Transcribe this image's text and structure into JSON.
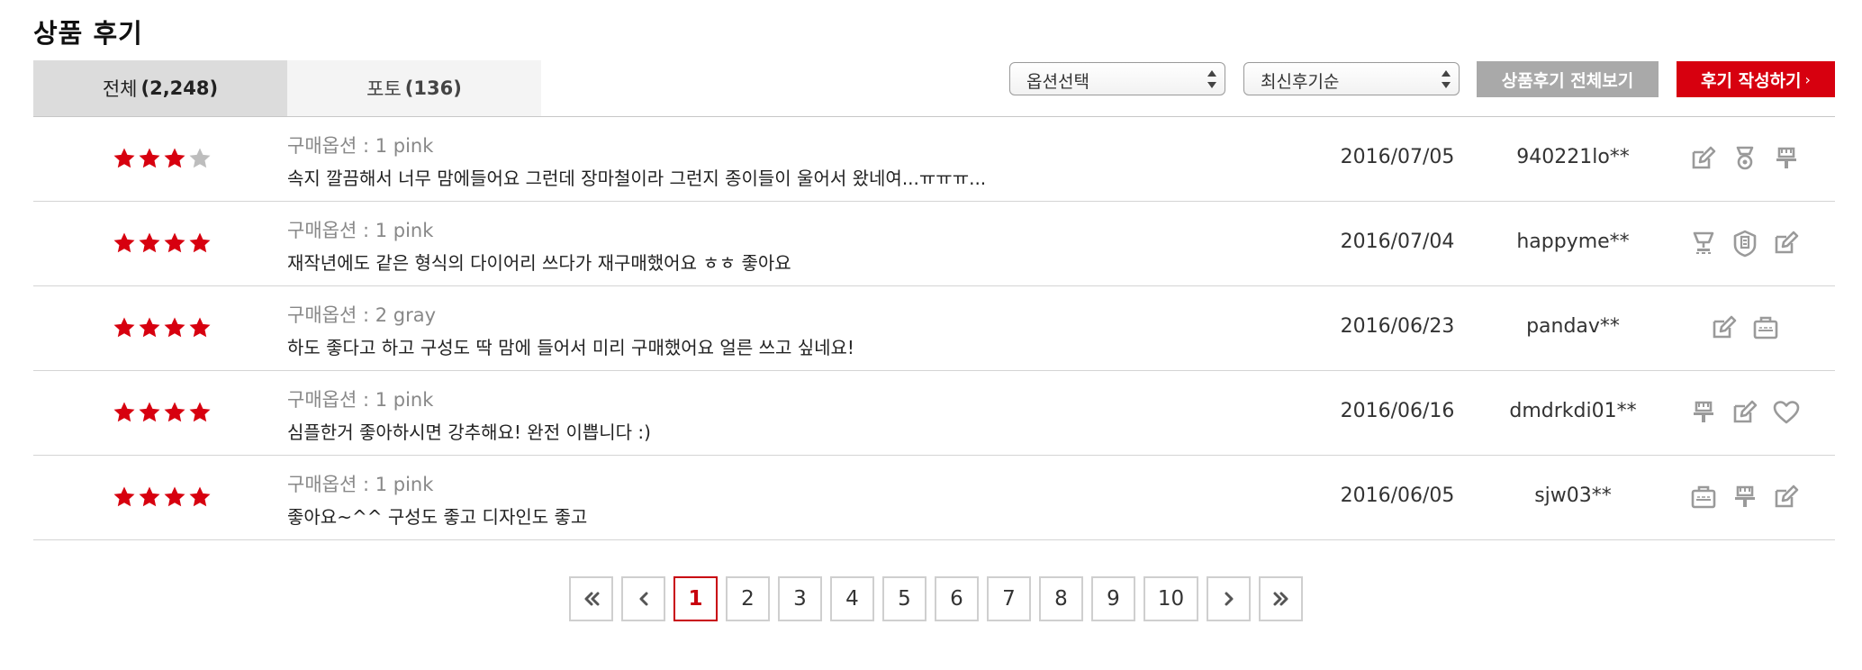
{
  "header": {
    "title": "상품 후기"
  },
  "tabs": [
    {
      "label": "전체",
      "count": "2,248"
    },
    {
      "label": "포토",
      "count": "136"
    }
  ],
  "filters": {
    "option_select": "옵션선택",
    "sort_select": "최신후기순"
  },
  "buttons": {
    "view_all": "상품후기 전체보기",
    "write": "후기 작성하기",
    "write_chevron": "›"
  },
  "colors": {
    "star": "#d7000f",
    "star_empty": "#bdbdbd",
    "icon": "#9a9a9a",
    "accent": "#d7000f"
  },
  "reviews": [
    {
      "rating": 3,
      "option": "구매옵션 : 1 pink",
      "text": "속지 깔끔해서 너무 맘에들어요 그런데 장마철이라 그런지 종이들이 울어서 왔네여...ㅠㅠㅠ...",
      "date": "2016/07/05",
      "user": "940221lo**",
      "icons": [
        "edit-icon",
        "medal-icon",
        "brush-icon"
      ]
    },
    {
      "rating": 4,
      "option": "구매옵션 : 1 pink",
      "text": "재작년에도 같은 형식의 다이어리 쓰다가 재구매했어요 ㅎㅎ 좋아요",
      "date": "2016/07/04",
      "user": "happyme**",
      "icons": [
        "trophy-icon",
        "badge-icon",
        "edit-icon"
      ]
    },
    {
      "rating": 4,
      "option": "구매옵션 : 2 gray",
      "text": "하도 좋다고 하고 구성도 딱 맘에 들어서 미리 구매했어요 얼른 쓰고 싶네요!",
      "date": "2016/06/23",
      "user": "pandav**",
      "icons": [
        "edit-icon",
        "briefcase-icon"
      ]
    },
    {
      "rating": 4,
      "option": "구매옵션 : 1 pink",
      "text": "심플한거 좋아하시면 강추해요! 완전 이쁩니다 :)",
      "date": "2016/06/16",
      "user": "dmdrkdi01**",
      "icons": [
        "brush-icon",
        "edit-icon",
        "heart-icon"
      ]
    },
    {
      "rating": 4,
      "option": "구매옵션 : 1 pink",
      "text": "좋아요~^^ 구성도 좋고 디자인도 좋고",
      "date": "2016/06/05",
      "user": "sjw03**",
      "icons": [
        "briefcase-icon",
        "brush-icon",
        "edit-icon"
      ]
    }
  ],
  "pagination": {
    "first_icon": "double-chevron-left-icon",
    "prev_icon": "chevron-left-icon",
    "pages": [
      "1",
      "2",
      "3",
      "4",
      "5",
      "6",
      "7",
      "8",
      "9",
      "10"
    ],
    "current": "1",
    "next_icon": "chevron-right-icon",
    "last_icon": "double-chevron-right-icon"
  }
}
